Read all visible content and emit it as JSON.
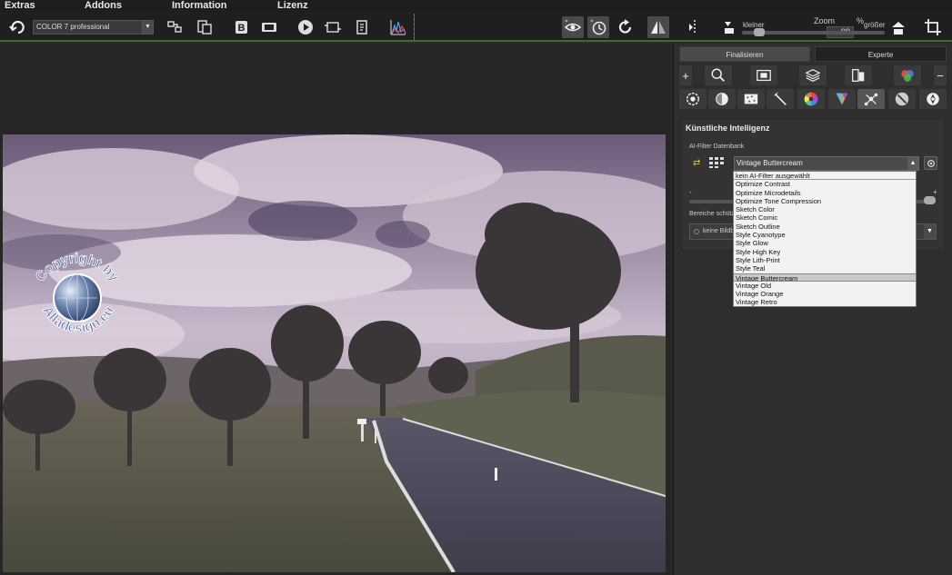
{
  "menu": {
    "items": [
      "Extras",
      "Addons",
      "Information",
      "Lizenz"
    ]
  },
  "toolbar": {
    "preset_value": "COLOR 7 professional",
    "zoom_label": "Zoom",
    "zoom_value": "99",
    "zoom_unit": "%",
    "smaller_label": "kleiner",
    "bigger_label": "größer",
    "zoom_fraction": 0.99
  },
  "panel": {
    "tabs": [
      "Finalisieren",
      "Experte"
    ],
    "row1_icons": [
      "plus-icon",
      "magnifier-icon",
      "frame-icon",
      "layers-icon",
      "split-view-icon",
      "color-balls-icon",
      "minus-icon"
    ],
    "row2_icons": [
      "detail-icon",
      "contrast-icon",
      "noise-icon",
      "wand-icon",
      "color-wheel-icon",
      "prism-icon",
      "nodes-icon",
      "ai-icon",
      "aperture-icon"
    ]
  },
  "ai": {
    "title": "Künstliche Intelligenz",
    "subtitle": "AI-Filter Datenbank",
    "selected": "Vintage Buttercream",
    "minus": "-",
    "plus": "+",
    "protect_label": "Bereiche schützen",
    "protect_value": "keine Bildbereiche",
    "options": [
      "kein AI-Filter ausgewählt",
      "Optimize Contrast",
      "Optimize Microdetails",
      "Optimize Tone Compression",
      "Sketch Color",
      "Sketch Comic",
      "Sketch Outline",
      "Style Cyanotype",
      "Style Glow",
      "Style High Key",
      "Style Lith-Print",
      "Style Teal",
      "Vintage Buttercream",
      "Vintage Old",
      "Vintage Orange",
      "Vintage Retro"
    ],
    "selected_index": 12
  },
  "watermark": {
    "text_top": "Copyright by",
    "text_bottom": "Alladesign.eu"
  },
  "colors": {
    "accent_green": "#3a6f2e",
    "reset_yellow": "#e6c23a"
  }
}
